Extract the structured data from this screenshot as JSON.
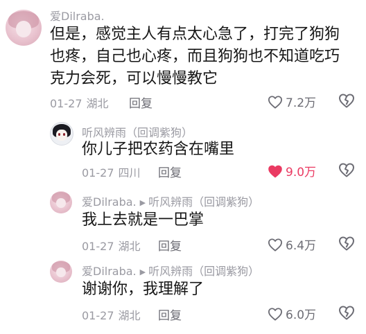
{
  "colors": {
    "liked_heart": "#ea3a62",
    "meta_gray": "#9a9aa2"
  },
  "comments": [
    {
      "user": "爱Dilraba.",
      "lines": [
        "但是，感觉主人有点太心急了，打完了狗狗",
        "也疼，自己也心疼，而且狗狗也不知道吃巧",
        "克力会死，可以慢慢教它"
      ],
      "date": "01-27",
      "location": "湖北",
      "reply": "回复",
      "likes": "7.2万",
      "liked": false,
      "avatar_icon": "pink-anime-girl-avatar"
    },
    {
      "user": "听风辨雨（回调紫狗）",
      "lines": [
        "你儿子把农药含在嘴里"
      ],
      "date": "01-27",
      "location": "四川",
      "reply": "回复",
      "likes": "9.0万",
      "liked": true,
      "avatar_icon": "anime-dog-avatar"
    },
    {
      "user": "爱Dilraba.",
      "reply_to": "听风辨雨（回调紫狗）",
      "lines": [
        "我上去就是一巴掌"
      ],
      "date": "01-27",
      "location": "湖北",
      "reply": "回复",
      "likes": "6.4万",
      "liked": false,
      "avatar_icon": "pink-anime-girl-avatar"
    },
    {
      "user": "爱Dilraba.",
      "reply_to": "听风辨雨（回调紫狗）",
      "lines": [
        "谢谢你，我理解了"
      ],
      "date": "01-27",
      "location": "湖北",
      "reply": "回复",
      "likes": "6.0万",
      "liked": false,
      "avatar_icon": "pink-anime-girl-avatar"
    }
  ]
}
